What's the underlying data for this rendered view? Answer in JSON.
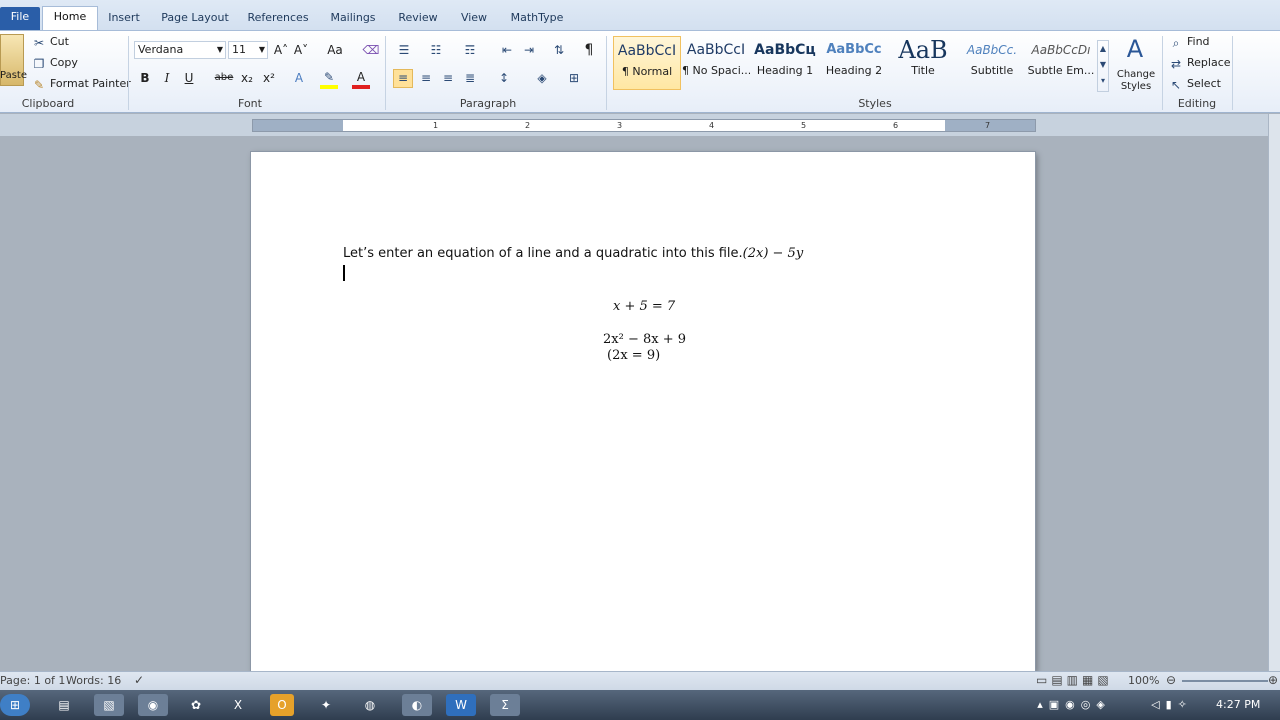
{
  "tabs": [
    "File",
    "Home",
    "Insert",
    "Page Layout",
    "References",
    "Mailings",
    "Review",
    "View",
    "MathType"
  ],
  "clipboard": {
    "paste": "Paste",
    "cut": "Cut",
    "copy": "Copy",
    "format_painter": "Format Painter",
    "group": "Clipboard"
  },
  "font": {
    "name": "Verdana",
    "size": "11",
    "group": "Font",
    "grow": "A˄",
    "shrink": "A˅",
    "case": "Aa",
    "bold": "B",
    "italic": "I",
    "underline": "U",
    "strike": "abe",
    "sub": "x₂",
    "sup": "x²",
    "highlight_color": "#ffff00",
    "font_color": "#e02020"
  },
  "paragraph": {
    "group": "Paragraph",
    "pilcrow": "¶"
  },
  "styles": {
    "group": "Styles",
    "items": [
      {
        "preview": "AaBbCcI",
        "label": "¶ Normal"
      },
      {
        "preview": "AaBbCcI",
        "label": "¶ No Spaci..."
      },
      {
        "preview": "AaBbCц",
        "label": "Heading 1"
      },
      {
        "preview": "AaBbCc",
        "label": "Heading 2"
      },
      {
        "preview": "AaB",
        "label": "Title"
      },
      {
        "preview": "AaBbCc.",
        "label": "Subtitle"
      },
      {
        "preview": "AaBbCcDı",
        "label": "Subtle Em..."
      }
    ],
    "change_styles": "Change Styles"
  },
  "editing": {
    "group": "Editing",
    "find": "Find",
    "replace": "Replace",
    "select": "Select"
  },
  "ruler_numbers": [
    "1",
    "2",
    "3",
    "4",
    "5",
    "6",
    "7"
  ],
  "document": {
    "line1": "Let’s enter an equation of a line and a quadratic into this file.",
    "line1_math": "(2x) − 5y",
    "eq1": "x + 5 = 7",
    "eq2": "2x² − 8x + 9",
    "eq3": "(2x = 9)"
  },
  "status": {
    "page": "Page: 1 of 1",
    "words": "Words: 16",
    "zoom": "100%"
  },
  "taskbar": {
    "time": "4:27 PM"
  }
}
